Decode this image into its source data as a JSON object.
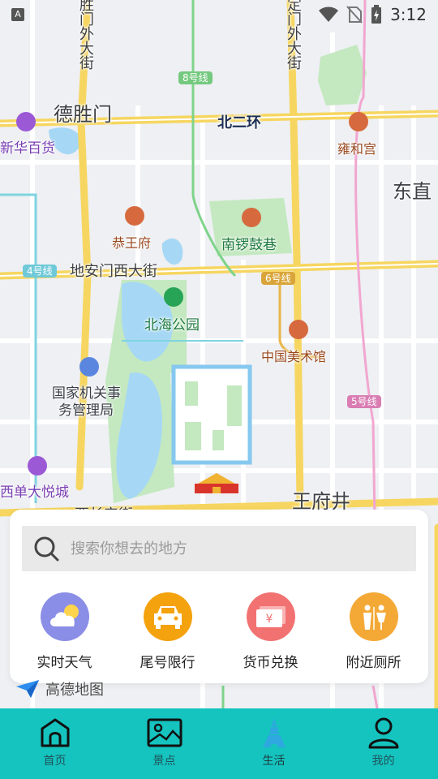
{
  "status_bar": {
    "time": "3:12",
    "notif_icon": "A"
  },
  "map": {
    "labels": {
      "deshengmen": "德胜门",
      "beierhuan": "北二环",
      "xinhua": "新华百货",
      "yonghegong": "雍和宫",
      "dongzhi": "东直",
      "gongwangfu": "恭王府",
      "nanluoguxiang": "南锣鼓巷",
      "dianmen": "地安门西大街",
      "beihai": "北海公园",
      "meishuguan": "中国美术馆",
      "guojiajiguan_1": "国家机关事",
      "guojiajiguan_2": "务管理局",
      "xidan": "西单大悦城",
      "wangfujing": "王府井",
      "xichangan": "西长安街",
      "left_vertical": "德胜门外大街",
      "right_vertical": "安定门外大街"
    },
    "badges": {
      "line8": "8号线",
      "line4": "4号线",
      "line6": "6号线",
      "line5": "5号线"
    },
    "logo_text": "高德地图"
  },
  "search": {
    "placeholder": "搜索你想去的地方"
  },
  "actions": [
    {
      "label": "实时天气",
      "icon": "weather-cloud-sun-icon",
      "color": "#8a8ee6"
    },
    {
      "label": "尾号限行",
      "icon": "car-icon",
      "color": "#f4a20d"
    },
    {
      "label": "货币兑换",
      "icon": "currency-exchange-icon",
      "color": "#f27272"
    },
    {
      "label": "附近厕所",
      "icon": "restroom-icon",
      "color": "#f4a937"
    }
  ],
  "tabbar": {
    "active_color": "#2fa7e0",
    "tabs": [
      {
        "label": "首页",
        "icon": "home-icon"
      },
      {
        "label": "景点",
        "icon": "image-icon"
      },
      {
        "label": "生活",
        "icon": "tower-icon"
      },
      {
        "label": "我的",
        "icon": "user-icon"
      }
    ]
  }
}
